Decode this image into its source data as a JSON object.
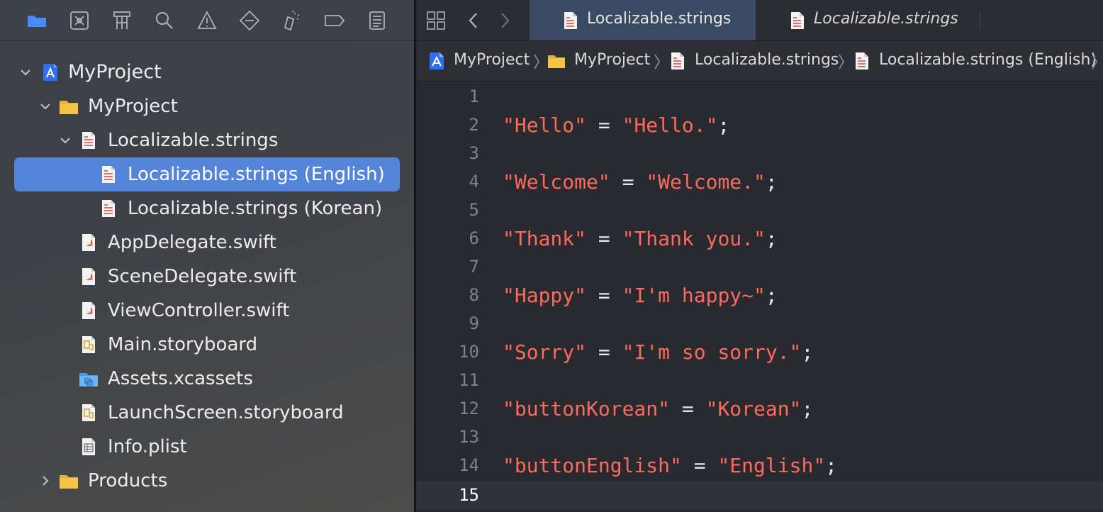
{
  "colors": {
    "selection": "#5585d8",
    "string": "#fc6a5d",
    "folder": "#f4c447",
    "swift": "#f05138",
    "active_tab": "#3a4a63",
    "editor_bg": "#292a30",
    "accent_blue": "#4a8cf7"
  },
  "navigator_toolbar": {
    "icons": [
      "folder-icon",
      "source-control-icon",
      "symbol-icon",
      "search-icon",
      "warning-icon",
      "test-icon",
      "debug-icon",
      "breakpoint-icon",
      "report-icon"
    ]
  },
  "tree": {
    "items": [
      {
        "label": "MyProject",
        "icon": "xcode-project-icon",
        "expanded": true
      },
      {
        "label": "MyProject",
        "icon": "folder-icon",
        "expanded": true
      },
      {
        "label": "Localizable.strings",
        "icon": "strings-file-icon",
        "expanded": true
      },
      {
        "label": "Localizable.strings (English)",
        "icon": "strings-file-icon",
        "selected": true
      },
      {
        "label": "Localizable.strings (Korean)",
        "icon": "strings-file-icon"
      },
      {
        "label": "AppDelegate.swift",
        "icon": "swift-file-icon"
      },
      {
        "label": "SceneDelegate.swift",
        "icon": "swift-file-icon"
      },
      {
        "label": "ViewController.swift",
        "icon": "swift-file-icon"
      },
      {
        "label": "Main.storyboard",
        "icon": "storyboard-icon"
      },
      {
        "label": "Assets.xcassets",
        "icon": "assets-folder-icon"
      },
      {
        "label": "LaunchScreen.storyboard",
        "icon": "storyboard-icon"
      },
      {
        "label": "Info.plist",
        "icon": "plist-icon"
      },
      {
        "label": "Products",
        "icon": "folder-icon",
        "expanded": false
      }
    ]
  },
  "tabs": [
    {
      "label": "Localizable.strings",
      "active": true
    },
    {
      "label": "Localizable.strings",
      "active": false
    }
  ],
  "jumpbar": {
    "items": [
      {
        "label": "MyProject",
        "icon": "xcode-project-icon"
      },
      {
        "label": "MyProject",
        "icon": "folder-icon"
      },
      {
        "label": "Localizable.strings",
        "icon": "strings-file-icon"
      },
      {
        "label": "Localizable.strings (English)",
        "icon": "strings-file-icon"
      }
    ]
  },
  "editor": {
    "current_line": "15",
    "lines": [
      {
        "n": "1",
        "key": "",
        "eq": "",
        "value": "",
        "semi": ""
      },
      {
        "n": "2",
        "key": "\"Hello\"",
        "eq": " = ",
        "value": "\"Hello.\"",
        "semi": ";"
      },
      {
        "n": "3",
        "key": "",
        "eq": "",
        "value": "",
        "semi": ""
      },
      {
        "n": "4",
        "key": "\"Welcome\"",
        "eq": " = ",
        "value": "\"Welcome.\"",
        "semi": ";"
      },
      {
        "n": "5",
        "key": "",
        "eq": "",
        "value": "",
        "semi": ""
      },
      {
        "n": "6",
        "key": "\"Thank\"",
        "eq": " = ",
        "value": "\"Thank you.\"",
        "semi": ";"
      },
      {
        "n": "7",
        "key": "",
        "eq": "",
        "value": "",
        "semi": ""
      },
      {
        "n": "8",
        "key": "\"Happy\"",
        "eq": " = ",
        "value": "\"I'm happy~\"",
        "semi": ";"
      },
      {
        "n": "9",
        "key": "",
        "eq": "",
        "value": "",
        "semi": ""
      },
      {
        "n": "10",
        "key": "\"Sorry\"",
        "eq": " = ",
        "value": "\"I'm so sorry.\"",
        "semi": ";"
      },
      {
        "n": "11",
        "key": "",
        "eq": "",
        "value": "",
        "semi": ""
      },
      {
        "n": "12",
        "key": "\"buttonKorean\"",
        "eq": " = ",
        "value": "\"Korean\"",
        "semi": ";"
      },
      {
        "n": "13",
        "key": "",
        "eq": "",
        "value": "",
        "semi": ""
      },
      {
        "n": "14",
        "key": "\"buttonEnglish\"",
        "eq": " = ",
        "value": "\"English\"",
        "semi": ";"
      },
      {
        "n": "15",
        "key": "",
        "eq": "",
        "value": "",
        "semi": ""
      }
    ]
  }
}
